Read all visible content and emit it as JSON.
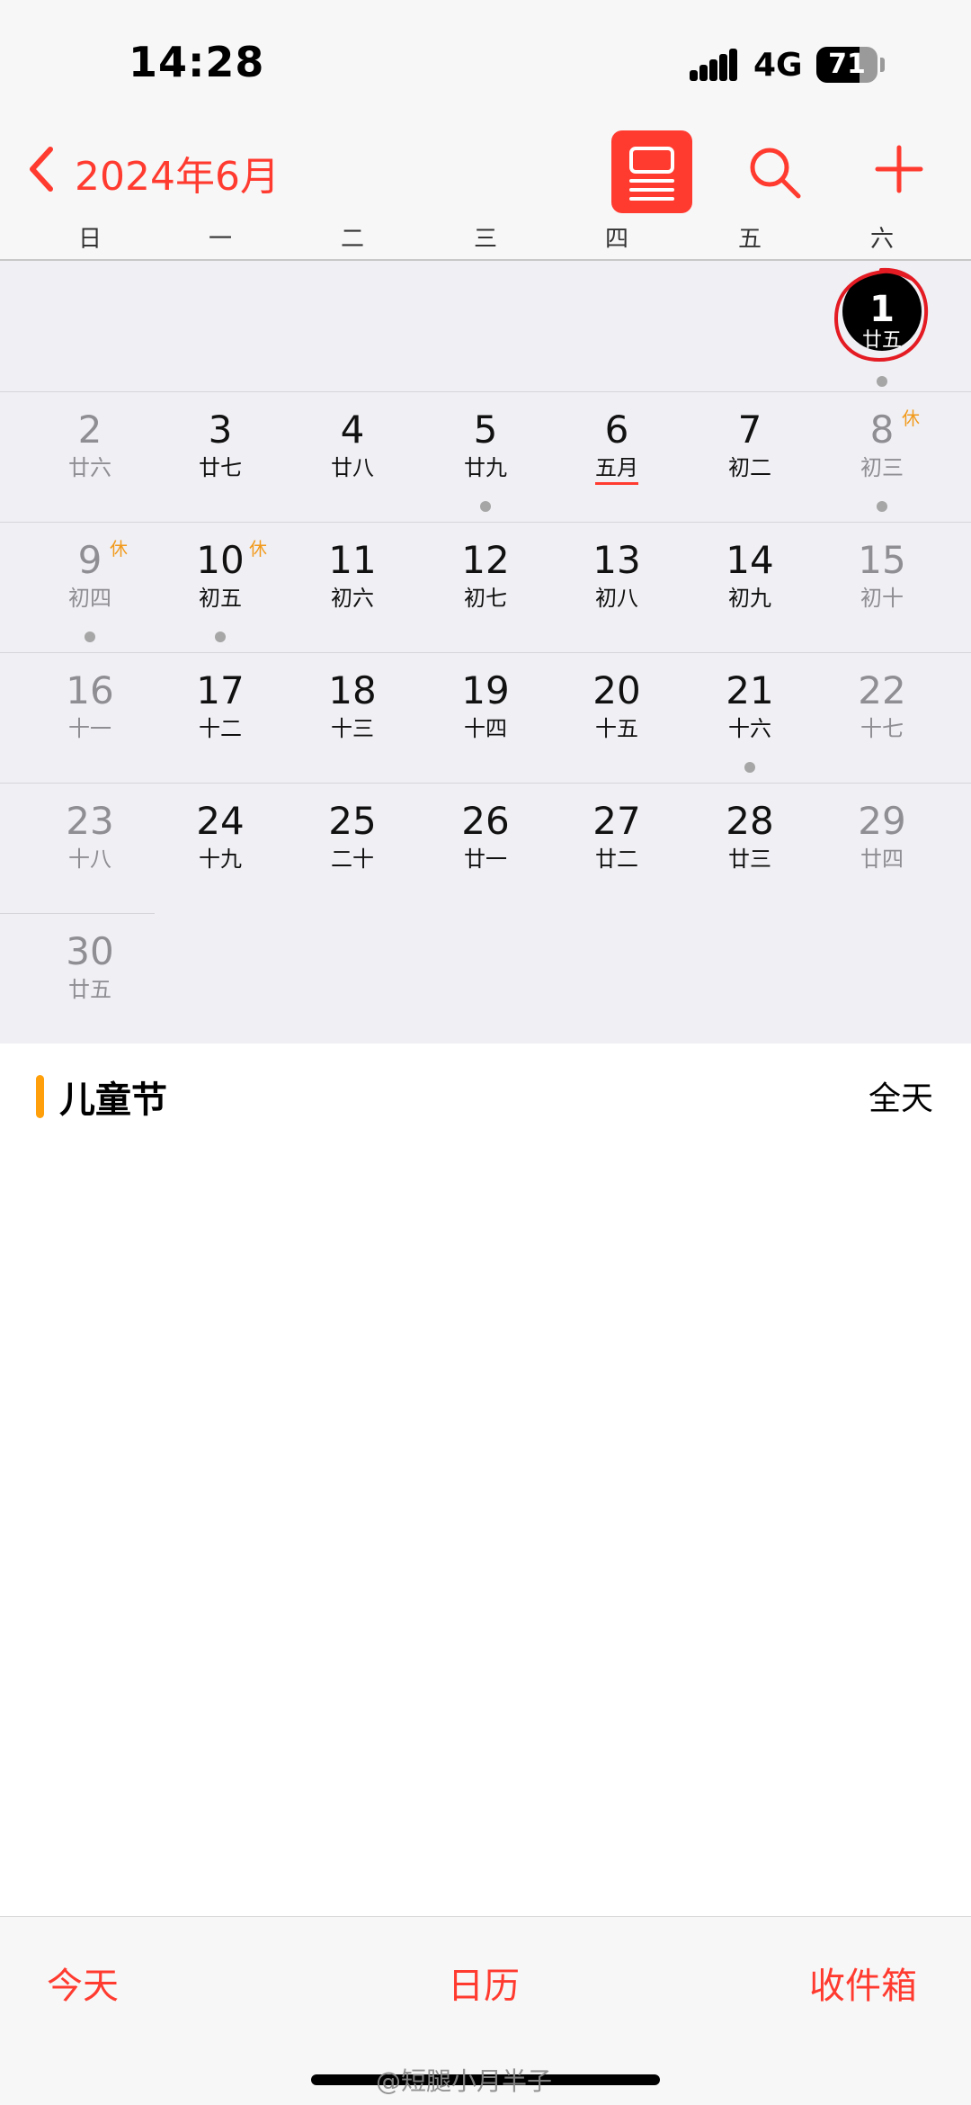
{
  "status_bar": {
    "time": "14:28",
    "network": "4G",
    "battery": "71",
    "battery_level": 0.71
  },
  "nav": {
    "title": "2024年6月"
  },
  "weekdays": [
    "日",
    "一",
    "二",
    "三",
    "四",
    "五",
    "六"
  ],
  "calendar": {
    "weeks": [
      [
        null,
        null,
        null,
        null,
        null,
        null,
        {
          "day": "1",
          "lunar": "廿五",
          "today": true,
          "dot": true,
          "weekend": true
        }
      ],
      [
        {
          "day": "2",
          "lunar": "廿六",
          "weekend": true
        },
        {
          "day": "3",
          "lunar": "廿七"
        },
        {
          "day": "4",
          "lunar": "廿八"
        },
        {
          "day": "5",
          "lunar": "廿九",
          "dot": true
        },
        {
          "day": "6",
          "lunar": "五月",
          "underline": true
        },
        {
          "day": "7",
          "lunar": "初二"
        },
        {
          "day": "8",
          "lunar": "初三",
          "weekend": true,
          "badge": "休",
          "dot": true
        }
      ],
      [
        {
          "day": "9",
          "lunar": "初四",
          "weekend": true,
          "badge": "休",
          "dot": true
        },
        {
          "day": "10",
          "lunar": "初五",
          "badge": "休",
          "dot": true
        },
        {
          "day": "11",
          "lunar": "初六"
        },
        {
          "day": "12",
          "lunar": "初七"
        },
        {
          "day": "13",
          "lunar": "初八"
        },
        {
          "day": "14",
          "lunar": "初九"
        },
        {
          "day": "15",
          "lunar": "初十",
          "weekend": true
        }
      ],
      [
        {
          "day": "16",
          "lunar": "十一",
          "weekend": true
        },
        {
          "day": "17",
          "lunar": "十二"
        },
        {
          "day": "18",
          "lunar": "十三"
        },
        {
          "day": "19",
          "lunar": "十四"
        },
        {
          "day": "20",
          "lunar": "十五"
        },
        {
          "day": "21",
          "lunar": "十六",
          "dot": true
        },
        {
          "day": "22",
          "lunar": "十七",
          "weekend": true
        }
      ],
      [
        {
          "day": "23",
          "lunar": "十八",
          "weekend": true
        },
        {
          "day": "24",
          "lunar": "十九"
        },
        {
          "day": "25",
          "lunar": "二十"
        },
        {
          "day": "26",
          "lunar": "廿一"
        },
        {
          "day": "27",
          "lunar": "廿二"
        },
        {
          "day": "28",
          "lunar": "廿三"
        },
        {
          "day": "29",
          "lunar": "廿四",
          "weekend": true
        }
      ],
      [
        {
          "day": "30",
          "lunar": "廿五",
          "weekend": true
        },
        null,
        null,
        null,
        null,
        null,
        null
      ]
    ]
  },
  "events": [
    {
      "title": "儿童节",
      "time": "全天",
      "color": "#ff9f0a"
    }
  ],
  "tabbar": {
    "today": "今天",
    "calendars": "日历",
    "inbox": "收件箱"
  },
  "watermark": "@短腿小月半子",
  "colors": {
    "accent": "#ff3b30",
    "holiday_badge": "#f29a1b",
    "event": "#ff9f0a"
  }
}
